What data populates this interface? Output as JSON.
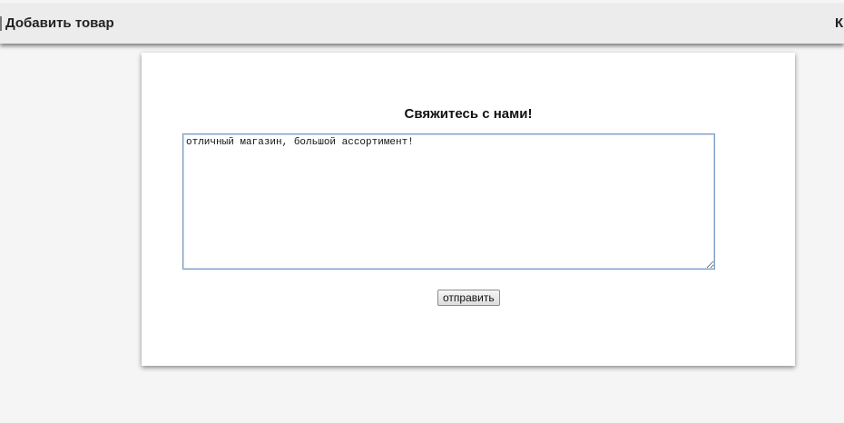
{
  "header": {
    "add_product_label": "Добавить товар",
    "right_link_label": "К"
  },
  "contact_form": {
    "title": "Свяжитесь с нами!",
    "message_value": "отличный магазин, большой ассортимент!",
    "submit_label": "отправить"
  }
}
